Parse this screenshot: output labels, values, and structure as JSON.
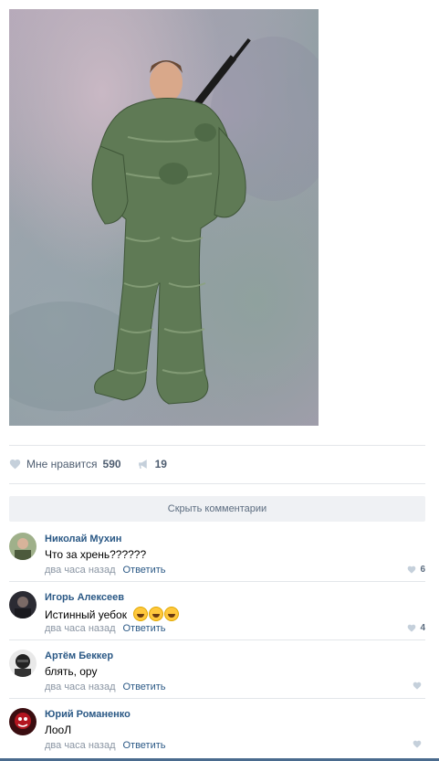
{
  "post": {
    "photo_icon": "photo-of-soldier-in-green-sleeping-bag-suit",
    "likes_label": "Мне нравится",
    "likes_count": "590",
    "shares_count": "19"
  },
  "comments_toggle": "Скрыть комментарии",
  "comments": [
    {
      "author": "Николай Мухин",
      "text": "Что за хрень??????",
      "time": "два часа назад",
      "reply": "Ответить",
      "likes": "6"
    },
    {
      "author": "Игорь Алексеев",
      "text": "Истинный уебок",
      "emoji_count": 3,
      "time": "два часа назад",
      "reply": "Ответить",
      "likes": "4"
    },
    {
      "author": "Артём Беккер",
      "text": "блять, ору",
      "time": "два часа назад",
      "reply": "Ответить",
      "likes": ""
    },
    {
      "author": "Юрий Романенко",
      "text": "ЛооЛ",
      "time": "два часа назад",
      "reply": "Ответить",
      "likes": ""
    }
  ],
  "colors": {
    "link": "#2a5885",
    "meta": "#8a95a3",
    "accent_bar": "#4a6b8e"
  }
}
